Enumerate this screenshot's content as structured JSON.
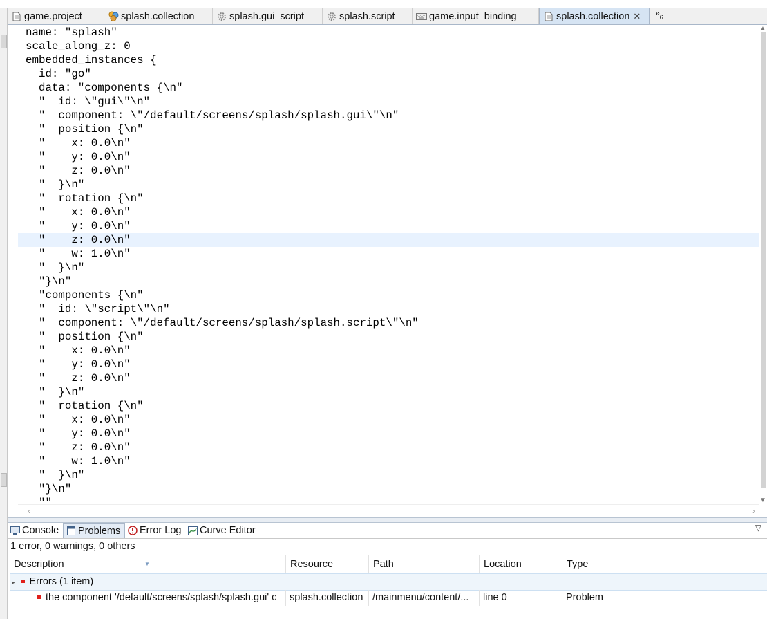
{
  "tabs": [
    {
      "label": "game.project",
      "icon": "document-icon"
    },
    {
      "label": "splash.collection",
      "icon": "collection-icon"
    },
    {
      "label": "splash.gui_script",
      "icon": "gear-icon"
    },
    {
      "label": "splash.script",
      "icon": "gear-icon"
    },
    {
      "label": "game.input_binding",
      "icon": "keyboard-icon"
    },
    {
      "label": "splash.collection",
      "icon": "document-icon",
      "active": true
    }
  ],
  "tab_overflow": {
    "glyph": "»",
    "count": "6"
  },
  "editor": {
    "lines": [
      "name: \"splash\"",
      "scale_along_z: 0",
      "embedded_instances {",
      "  id: \"go\"",
      "  data: \"components {\\n\"",
      "  \"  id: \\\"gui\\\"\\n\"",
      "  \"  component: \\\"/default/screens/splash/splash.gui\\\"\\n\"",
      "  \"  position {\\n\"",
      "  \"    x: 0.0\\n\"",
      "  \"    y: 0.0\\n\"",
      "  \"    z: 0.0\\n\"",
      "  \"  }\\n\"",
      "  \"  rotation {\\n\"",
      "  \"    x: 0.0\\n\"",
      "  \"    y: 0.0\\n\"",
      "  \"    z: 0.0\\n\"",
      "  \"    w: 1.0\\n\"",
      "  \"  }\\n\"",
      "  \"}\\n\"",
      "  \"components {\\n\"",
      "  \"  id: \\\"script\\\"\\n\"",
      "  \"  component: \\\"/default/screens/splash/splash.script\\\"\\n\"",
      "  \"  position {\\n\"",
      "  \"    x: 0.0\\n\"",
      "  \"    y: 0.0\\n\"",
      "  \"    z: 0.0\\n\"",
      "  \"  }\\n\"",
      "  \"  rotation {\\n\"",
      "  \"    x: 0.0\\n\"",
      "  \"    y: 0.0\\n\"",
      "  \"    z: 0.0\\n\"",
      "  \"    w: 1.0\\n\"",
      "  \"  }\\n\"",
      "  \"}\\n\"",
      "  \"\""
    ],
    "highlighted_line": 15
  },
  "panel": {
    "tabs": [
      {
        "label": "Console",
        "icon": "console-icon"
      },
      {
        "label": "Problems",
        "icon": "problems-icon",
        "active": true
      },
      {
        "label": "Error Log",
        "icon": "error-log-icon"
      },
      {
        "label": "Curve Editor",
        "icon": "curve-editor-icon"
      }
    ],
    "summary": "1 error, 0 warnings, 0 others",
    "columns": [
      "Description",
      "Resource",
      "Path",
      "Location",
      "Type"
    ],
    "group": {
      "label": "Errors (1 item)"
    },
    "problems": [
      {
        "description": "the component '/default/screens/splash/splash.gui' c",
        "resource": "splash.collection",
        "path": "/mainmenu/content/...",
        "location": "line 0",
        "type": "Problem"
      }
    ]
  }
}
